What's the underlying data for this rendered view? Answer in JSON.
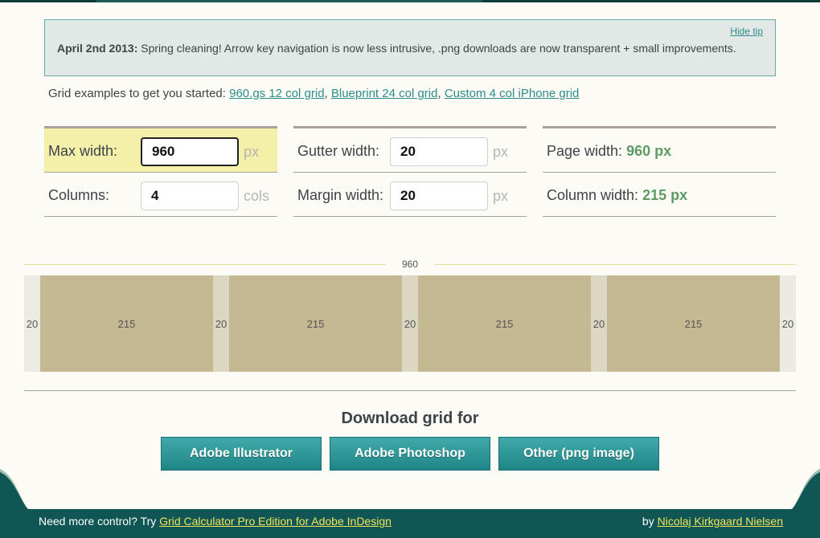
{
  "tip": {
    "hide_label": "Hide tip",
    "date": "April 2nd 2013:",
    "message": "Spring cleaning! Arrow key navigation is now less intrusive, .png downloads are now transparent + small improvements."
  },
  "examples": {
    "intro": "Grid examples to get you started:",
    "links": [
      "960.gs 12 col grid",
      "Blueprint 24 col grid",
      "Custom 4 col iPhone grid"
    ]
  },
  "settings": {
    "max_width": {
      "label": "Max width:",
      "value": "960",
      "unit": "px"
    },
    "columns": {
      "label": "Columns:",
      "value": "4",
      "unit": "cols"
    },
    "gutter_width": {
      "label": "Gutter width:",
      "value": "20",
      "unit": "px"
    },
    "margin_width": {
      "label": "Margin width:",
      "value": "20",
      "unit": "px"
    }
  },
  "results": {
    "page_width": {
      "label": "Page width:",
      "value": "960 px"
    },
    "column_width": {
      "label": "Column width:",
      "value": "215 px"
    }
  },
  "preview": {
    "total": "960",
    "margin": 20,
    "gutter": 20,
    "column": 215,
    "columns": 4
  },
  "download": {
    "title": "Download grid for",
    "buttons": [
      "Adobe Illustrator",
      "Adobe Photoshop",
      "Other (png image)"
    ]
  },
  "footer": {
    "left_text": "Need more control? Try",
    "left_link": "Grid Calculator Pro Edition for Adobe InDesign",
    "right_text": "by",
    "right_link": "Nicolaj Kirkgaard Nielsen"
  },
  "colors": {
    "accent": "#2d8c8a",
    "footer_bg": "#0f5655",
    "highlight": "#f5f0a9",
    "result_value": "#5e9a63"
  }
}
